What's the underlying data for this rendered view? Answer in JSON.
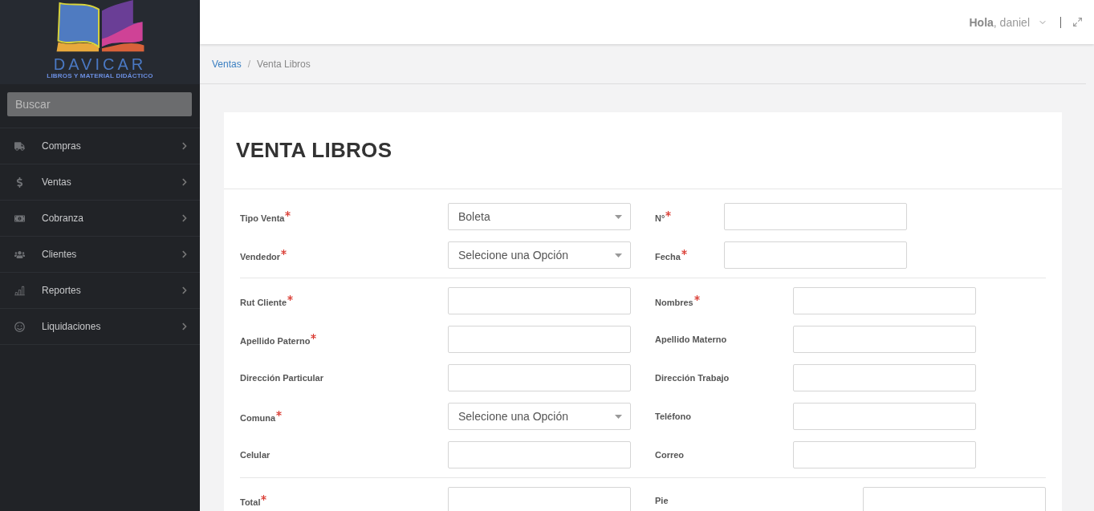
{
  "logo": {
    "name": "DAVICAR",
    "tagline": "LIBROS Y MATERIAL DIDÁCTICO"
  },
  "search": {
    "placeholder": "Buscar"
  },
  "menu": [
    {
      "label": "Compras"
    },
    {
      "label": "Ventas"
    },
    {
      "label": "Cobranza"
    },
    {
      "label": "Clientes"
    },
    {
      "label": "Reportes"
    },
    {
      "label": "Liquidaciones"
    }
  ],
  "header": {
    "greeting": "**Hola**, daniel"
  },
  "breadcrumb": {
    "separator": "/",
    "items": [
      {
        "label": "Ventas",
        "link": true
      },
      {
        "label": "Venta Libros",
        "link": false
      }
    ]
  },
  "form": {
    "title": "VENTA LIBROS",
    "sections": [
      {
        "rows": [
          [
            {
              "label": "Tipo Venta",
              "required": true,
              "kind": "select",
              "value": "Boleta"
            },
            {
              "label": "N°",
              "required": true,
              "kind": "text"
            }
          ],
          [
            {
              "label": "Vendedor",
              "required": true,
              "kind": "select",
              "value": "Selecione una Opción"
            },
            {
              "label": "Fecha",
              "required": true,
              "kind": "text"
            }
          ]
        ]
      },
      {
        "rows": [
          [
            {
              "label": "Rut Cliente",
              "required": true,
              "kind": "text"
            },
            {
              "label": "Nombres",
              "required": true,
              "kind": "text"
            }
          ],
          [
            {
              "label": "Apellido Paterno",
              "required": true,
              "kind": "text"
            },
            {
              "label": "Apellido Materno",
              "required": false,
              "kind": "text"
            }
          ],
          [
            {
              "label": "Dirección Particular",
              "required": false,
              "kind": "text"
            },
            {
              "label": "Dirección Trabajo",
              "required": false,
              "kind": "text"
            }
          ],
          [
            {
              "label": "Comuna",
              "required": true,
              "kind": "select",
              "value": "Selecione una Opción"
            },
            {
              "label": "Teléfono",
              "required": false,
              "kind": "text"
            }
          ],
          [
            {
              "label": "Celular",
              "required": false,
              "kind": "text"
            },
            {
              "label": "Correo",
              "required": false,
              "kind": "text"
            }
          ]
        ]
      },
      {
        "rows": [
          [
            {
              "label": "Total",
              "required": true,
              "kind": "text"
            },
            {
              "label": "Pie",
              "required": false,
              "kind": "text"
            }
          ]
        ]
      }
    ]
  }
}
